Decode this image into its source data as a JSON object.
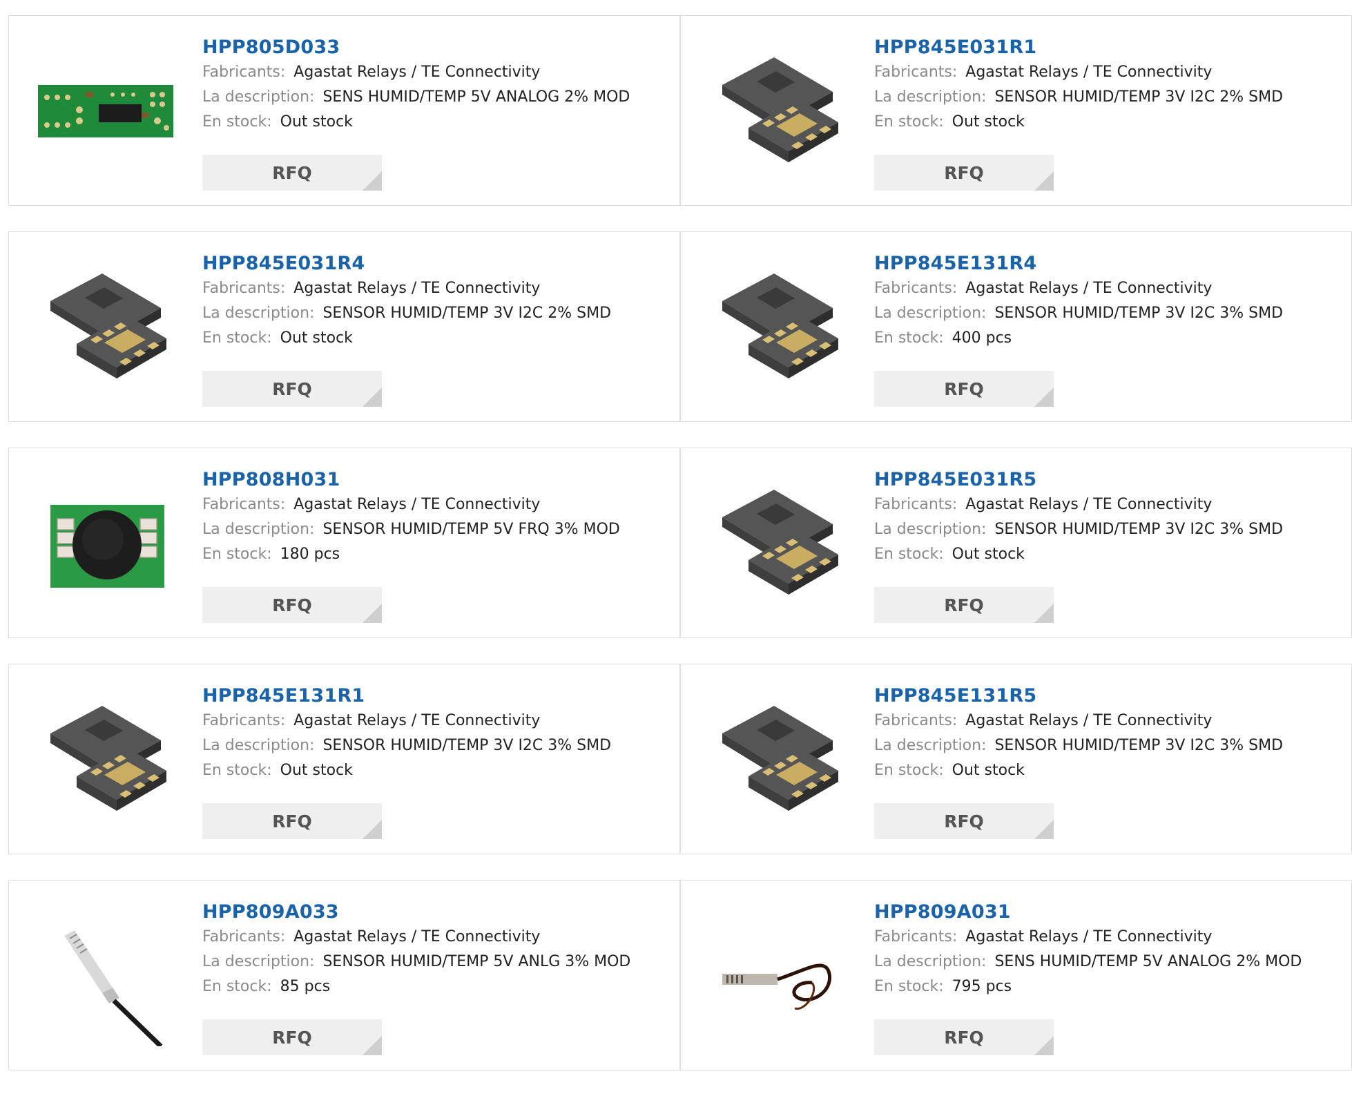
{
  "labels": {
    "manufacturer": "Fabricants:",
    "description": "La description:",
    "stock": "En stock:",
    "rfq": "RFQ"
  },
  "products": [
    {
      "pn": "HPP805D033",
      "manufacturer": "Agastat Relays / TE Connectivity",
      "description": "SENS HUMID/TEMP 5V ANALOG 2% MOD",
      "stock": "Out stock",
      "image": "pcb-module"
    },
    {
      "pn": "HPP845E031R1",
      "manufacturer": "Agastat Relays / TE Connectivity",
      "description": "SENSOR HUMID/TEMP 3V I2C 2% SMD",
      "stock": "Out stock",
      "image": "smd-chip"
    },
    {
      "pn": "HPP845E031R4",
      "manufacturer": "Agastat Relays / TE Connectivity",
      "description": "SENSOR HUMID/TEMP 3V I2C 2% SMD",
      "stock": "Out stock",
      "image": "smd-chip"
    },
    {
      "pn": "HPP845E131R4",
      "manufacturer": "Agastat Relays / TE Connectivity",
      "description": "SENSOR HUMID/TEMP 3V I2C 3% SMD",
      "stock": "400 pcs",
      "image": "smd-chip"
    },
    {
      "pn": "HPP808H031",
      "manufacturer": "Agastat Relays / TE Connectivity",
      "description": "SENSOR HUMID/TEMP 5V FRQ 3% MOD",
      "stock": "180 pcs",
      "image": "pcb-round"
    },
    {
      "pn": "HPP845E031R5",
      "manufacturer": "Agastat Relays / TE Connectivity",
      "description": "SENSOR HUMID/TEMP 3V I2C 3% SMD",
      "stock": "Out stock",
      "image": "smd-chip"
    },
    {
      "pn": "HPP845E131R1",
      "manufacturer": "Agastat Relays / TE Connectivity",
      "description": "SENSOR HUMID/TEMP 3V I2C 3% SMD",
      "stock": "Out stock",
      "image": "smd-chip"
    },
    {
      "pn": "HPP845E131R5",
      "manufacturer": "Agastat Relays / TE Connectivity",
      "description": "SENSOR HUMID/TEMP 3V I2C 3% SMD",
      "stock": "Out stock",
      "image": "smd-chip"
    },
    {
      "pn": "HPP809A033",
      "manufacturer": "Agastat Relays / TE Connectivity",
      "description": "SENSOR HUMID/TEMP 5V ANLG 3% MOD",
      "stock": "85 pcs",
      "image": "probe-cable"
    },
    {
      "pn": "HPP809A031",
      "manufacturer": "Agastat Relays / TE Connectivity",
      "description": "SENS HUMID/TEMP 5V ANALOG 2% MOD",
      "stock": "795 pcs",
      "image": "probe-coil"
    }
  ],
  "colors": {
    "link": "#1a63a8",
    "label": "#8a8a8a",
    "button_bg": "#efefef",
    "border": "#dedede"
  }
}
